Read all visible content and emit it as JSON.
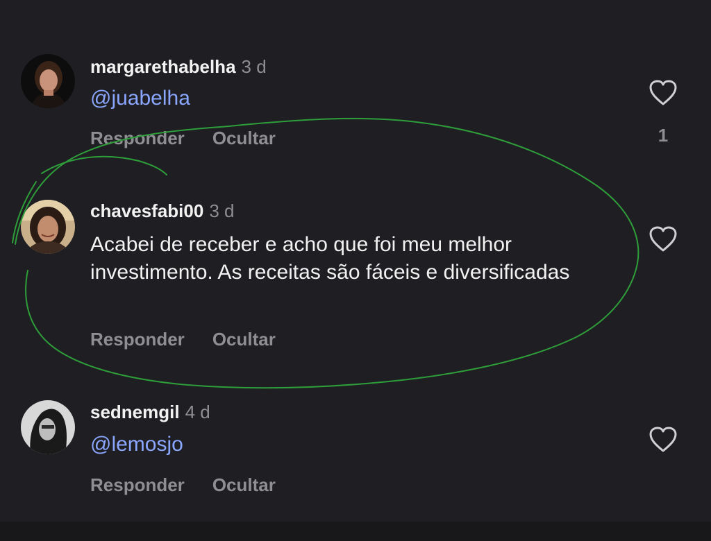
{
  "comments": [
    {
      "username": "margarethabelha",
      "time": "3 d",
      "text": "@juabelha",
      "is_mention": true,
      "reply_label": "Responder",
      "hide_label": "Ocultar",
      "likes": "1",
      "avatar_icon": "profile-photo"
    },
    {
      "username": "chavesfabi00",
      "time": "3 d",
      "text": "Acabei de receber e acho que foi meu melhor investimento. As receitas são fáceis e diversificadas",
      "is_mention": false,
      "reply_label": "Responder",
      "hide_label": "Ocultar",
      "likes": "",
      "avatar_icon": "profile-photo"
    },
    {
      "username": "sednemgil",
      "time": "4 d",
      "text": "@lemosjo",
      "is_mention": true,
      "reply_label": "Responder",
      "hide_label": "Ocultar",
      "likes": "",
      "avatar_icon": "profile-photo"
    }
  ],
  "icons": {
    "like": "heart-outline-icon"
  },
  "colors": {
    "background": "#1f1f23",
    "mention": "#8aa6ff",
    "secondary_text": "#8e8e93",
    "annotation": "#2e9e3a"
  }
}
